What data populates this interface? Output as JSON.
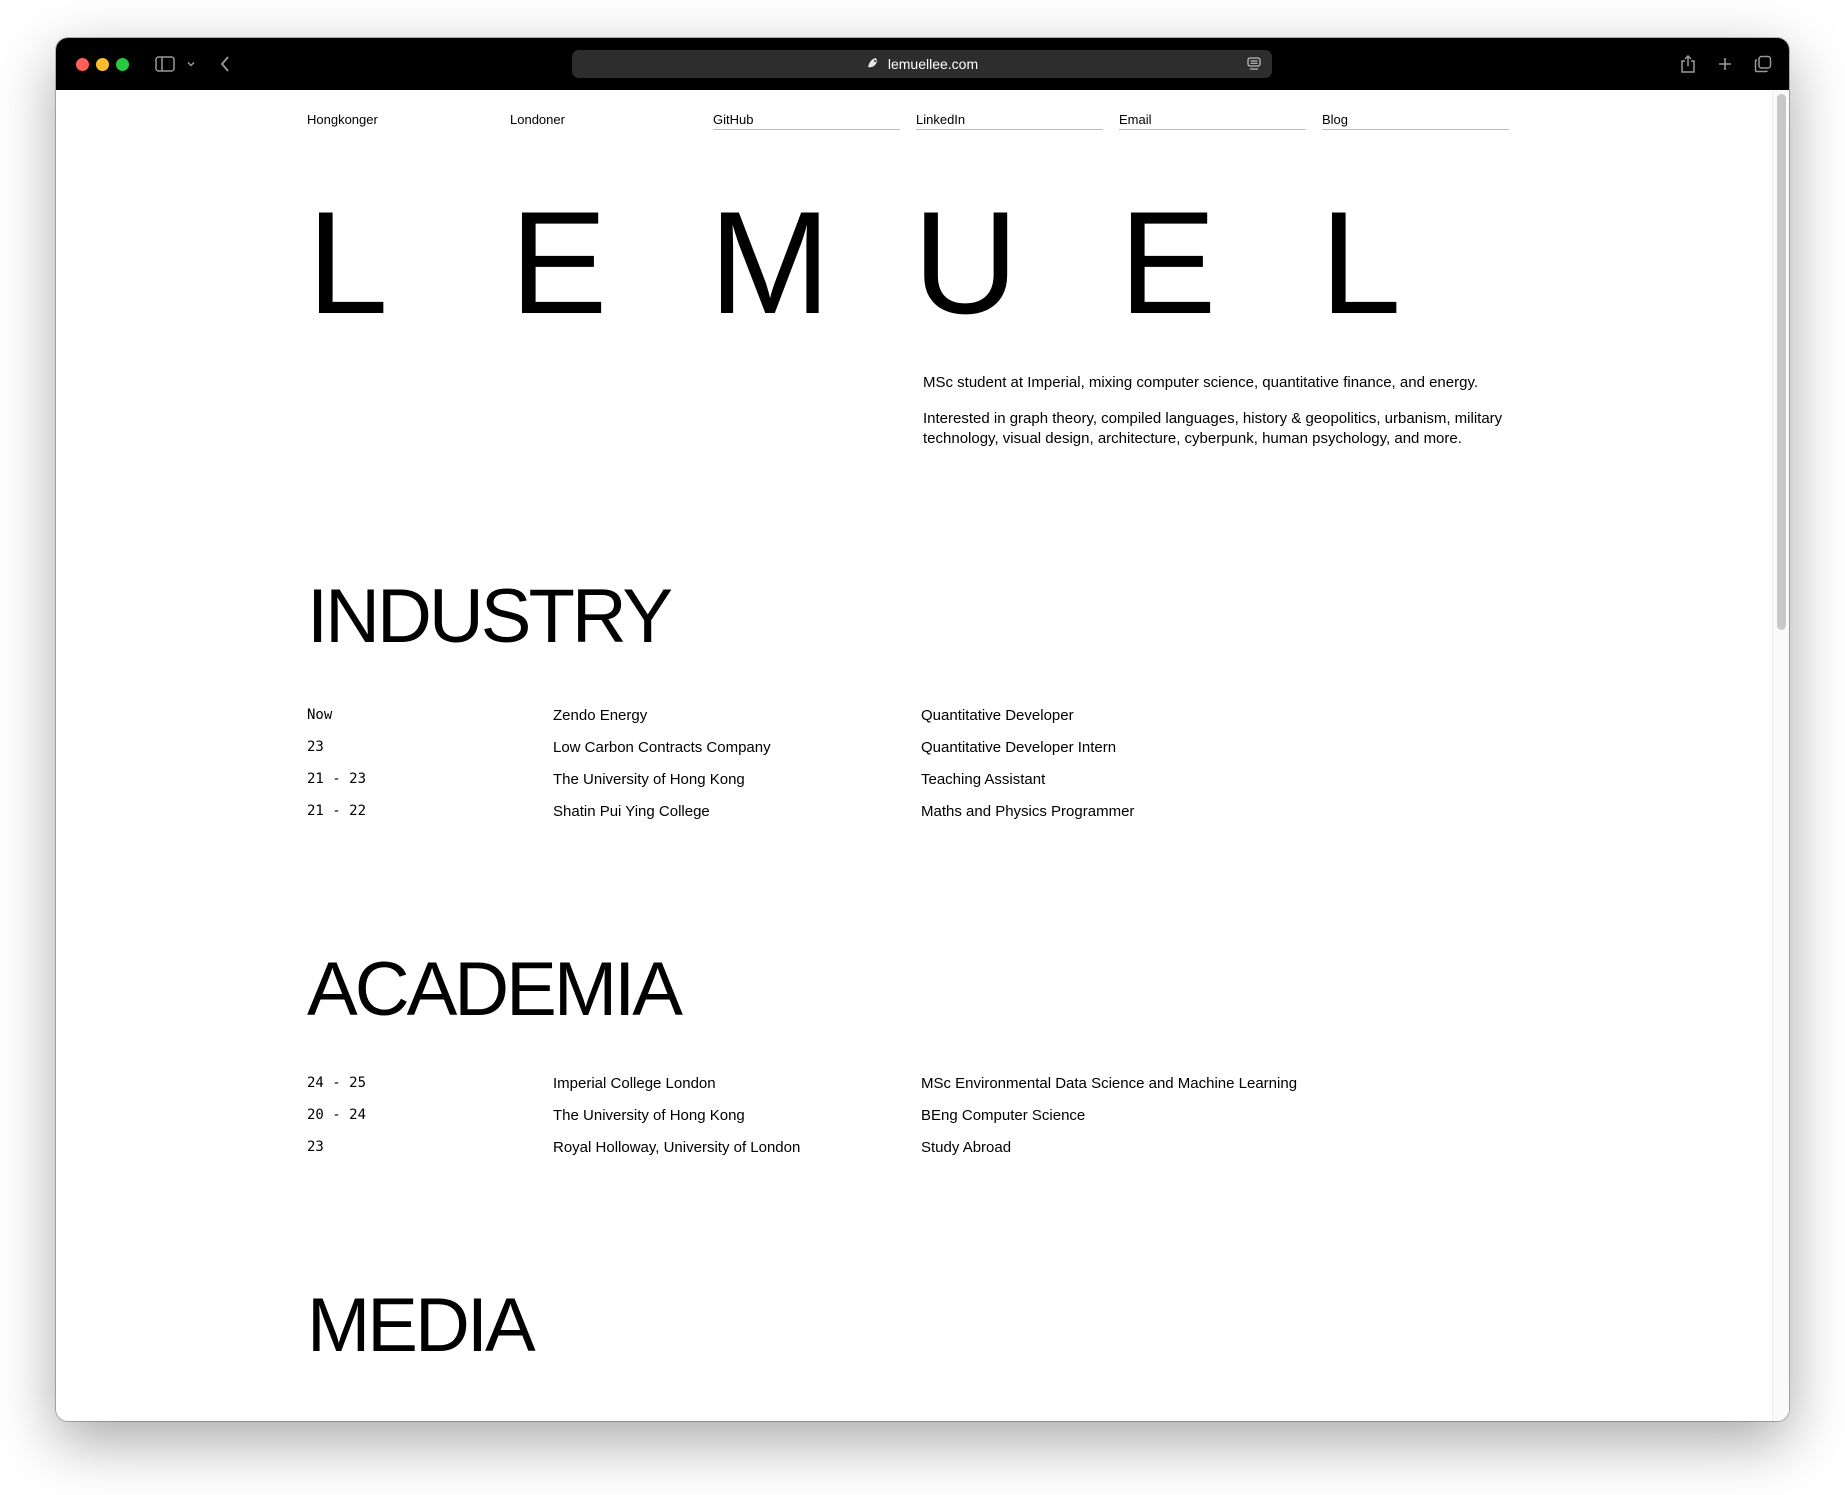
{
  "browser": {
    "url": "lemuellee.com"
  },
  "nav": {
    "items": [
      {
        "label": "Hongkonger"
      },
      {
        "label": "Londoner"
      },
      {
        "label": "GitHub"
      },
      {
        "label": "LinkedIn"
      },
      {
        "label": "Email"
      },
      {
        "label": "Blog"
      }
    ]
  },
  "hero": {
    "letters": [
      "L",
      "E",
      "M",
      "U",
      "E",
      "L"
    ]
  },
  "bio": {
    "line1": "MSc student at Imperial, mixing computer science, quantitative finance, and energy.",
    "line2": "Interested in graph theory, compiled languages, history & geopolitics, urbanism, military technology, visual design, architecture, cyberpunk, human psychology, and more."
  },
  "industry": {
    "title": "INDUSTRY",
    "rows": [
      {
        "period": "Now",
        "org": "Zendo Energy",
        "role": "Quantitative Developer"
      },
      {
        "period": "23",
        "org": "Low Carbon Contracts Company",
        "role": "Quantitative Developer Intern"
      },
      {
        "period": "21 - 23",
        "org": "The University of Hong Kong",
        "role": "Teaching Assistant"
      },
      {
        "period": "21 - 22",
        "org": "Shatin Pui Ying College",
        "role": "Maths and Physics Programmer"
      }
    ]
  },
  "academia": {
    "title": "ACADEMIA",
    "rows": [
      {
        "period": "24 - 25",
        "org": "Imperial College London",
        "role": "MSc Environmental Data Science and Machine Learning"
      },
      {
        "period": "20 - 24",
        "org": "The University of Hong Kong",
        "role": "BEng Computer Science"
      },
      {
        "period": "23",
        "org": "Royal Holloway, University of London",
        "role": "Study Abroad"
      }
    ]
  },
  "media": {
    "title": "MEDIA"
  }
}
